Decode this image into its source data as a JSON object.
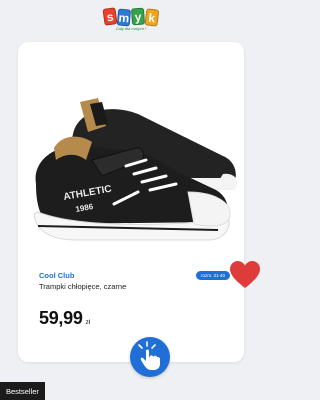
{
  "logo": {
    "letters": [
      "s",
      "m",
      "y",
      "k"
    ],
    "tile_colors": [
      "#e8412c",
      "#2e79d6",
      "#35a24b",
      "#f2a51c"
    ],
    "tagline": "Cały dla malych !"
  },
  "product": {
    "brand": "Cool Club",
    "size_badge": "rozm. 31-40",
    "name": "Trampki chłopięce, czarne",
    "price_value": "59,99",
    "price_currency": "zł",
    "image_icon": "sneaker-image",
    "image_print_text": "ATHLETIC",
    "image_print_year": "1986"
  },
  "actions": {
    "favorite_icon": "heart-icon",
    "favorite_color": "#e03b3b",
    "tap_icon": "hand-tap-icon"
  },
  "badge": {
    "bestseller_label": "Bestseller"
  },
  "colors": {
    "accent": "#1f6fd6",
    "background": "#eef0f3"
  }
}
